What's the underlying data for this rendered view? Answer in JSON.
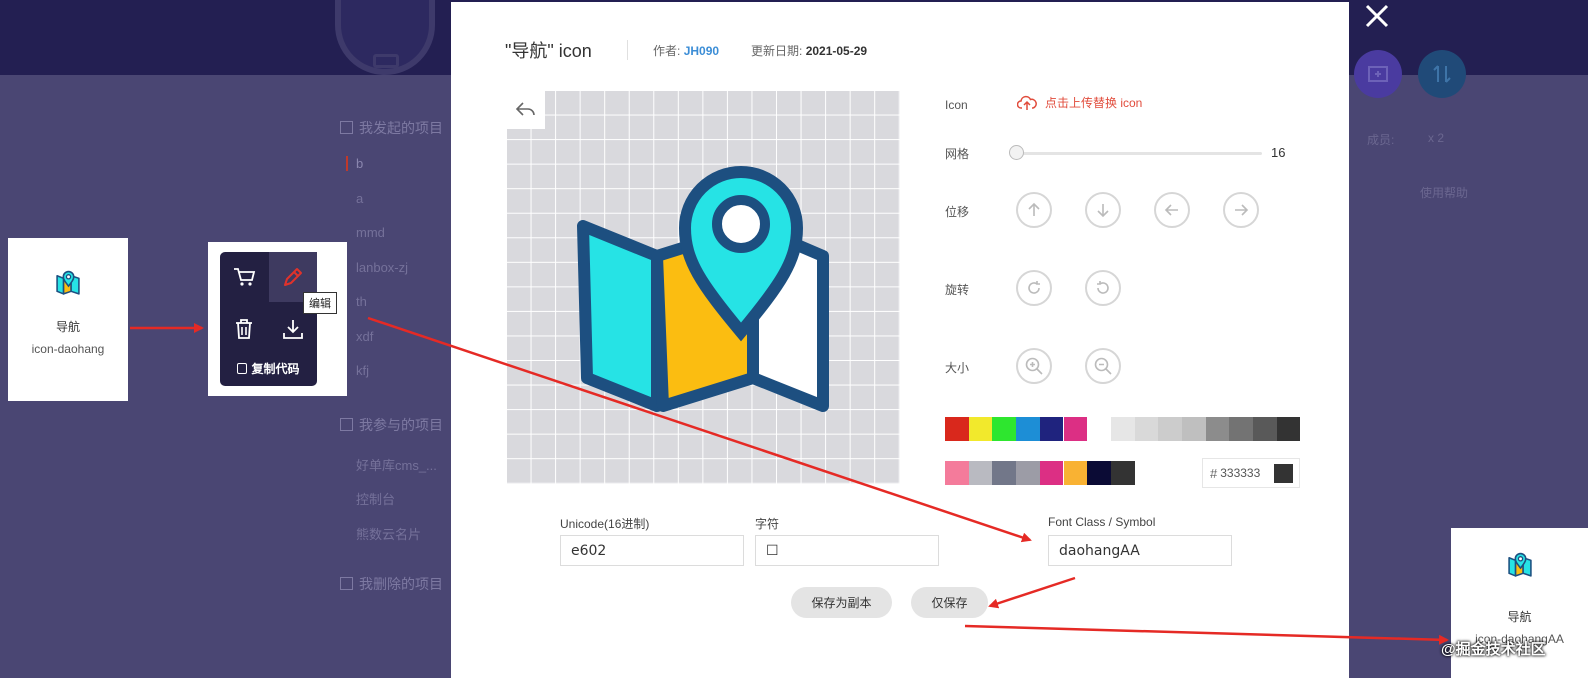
{
  "background": {
    "sidebar": {
      "section_mine": "我发起的项目",
      "projects": [
        "b",
        "a",
        "mmd",
        "lanbox-zj",
        "th",
        "xdf",
        "kfj"
      ],
      "section_joined": "我参与的项目",
      "joined": [
        "好单库cms_...",
        "控制台",
        "熊数云名片"
      ],
      "section_deleted": "我删除的项目"
    },
    "members_label": "成员:",
    "members_count": "x 2",
    "help_label": "使用帮助"
  },
  "source_card": {
    "name": "导航",
    "class_name": "icon-daohang"
  },
  "hover_card": {
    "ghost_name": "导航",
    "ghost_class": "icon-daohangAA",
    "tooltip": "编辑",
    "copy_label": "复制代码",
    "icons": [
      "cart-icon",
      "edit-icon",
      "trash-icon",
      "download-icon"
    ]
  },
  "result_card": {
    "name": "导航",
    "class_name": "icon-daohangAA"
  },
  "modal": {
    "title": "\"导航\" icon",
    "author_label": "作者:",
    "author": "JH090",
    "date_label": "更新日期:",
    "date": "2021-05-29",
    "icon_label": "Icon",
    "upload_label": "点击上传替换 icon",
    "grid_label": "网格",
    "grid_value": "16",
    "grid_fraction": 0.0,
    "move_label": "位移",
    "rotate_label": "旋转",
    "size_label": "大小",
    "swatches_row1": [
      "#d9281c",
      "#f2e92c",
      "#2ee62f",
      "#1d8ed6",
      "#1f237e",
      "#dc2f84",
      "#ffffff",
      "#e6e6e6",
      "#d9d9d9",
      "#cccccc",
      "#bfbfbf",
      "#8c8c8c",
      "#737373",
      "#595959",
      "#333333"
    ],
    "swatches_row2": [
      "#f47b9b",
      "#b9bac1",
      "#727789",
      "#9c9ca6",
      "#dc2f84",
      "#f9b233",
      "#0b0b35",
      "#333333"
    ],
    "hex_value": "333333",
    "unicode_label": "Unicode(16进制)",
    "unicode_value": "e602",
    "char_label": "字符",
    "char_value": "☐",
    "fontclass_label": "Font Class / Symbol",
    "fontclass_value": "daohangAA",
    "save_copy_label": "保存为副本",
    "save_only_label": "仅保存"
  },
  "watermark": "@掘金技术社区",
  "colors": {
    "overlay": "#4a4673",
    "header": "#231f52",
    "accent_red": "#e14c3c",
    "icon_cyan": "#26e3e5",
    "icon_yellow": "#fbbd11",
    "icon_stroke": "#1d4f80",
    "arrow_red": "#e52a25"
  }
}
